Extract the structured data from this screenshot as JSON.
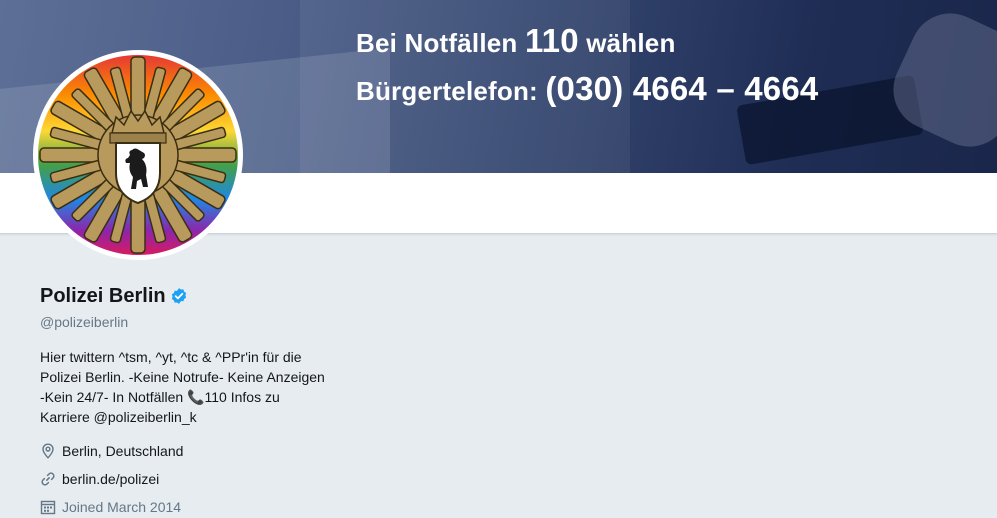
{
  "banner": {
    "line1_text": "Bei Notfällen ",
    "line1_number": "110",
    "line1_suffix": " wählen",
    "line2_label": "Bürgertelefon: ",
    "line2_number": "(030) 4664 – 4664"
  },
  "profile": {
    "display_name": "Polizei Berlin",
    "handle": "@polizeiberlin",
    "verified": true,
    "bio_lines": [
      "Hier twittern ^tsm, ^yt, ^tc & ^PPr'in für die",
      "Polizei Berlin. -Keine Notrufe- Keine Anzeigen",
      "-Kein 24/7- In Notfällen 📞110 Infos zu",
      "Karriere @polizeiberlin_k"
    ],
    "location": "Berlin, Deutschland",
    "website": "berlin.de/polizei",
    "joined": "Joined March 2014"
  },
  "icons": {
    "verified": "verified-badge-icon",
    "location": "location-pin-icon",
    "website": "link-icon",
    "joined": "calendar-icon"
  },
  "colors": {
    "accent": "#1da1f2",
    "muted": "#657786",
    "background": "#e6ecf0"
  }
}
